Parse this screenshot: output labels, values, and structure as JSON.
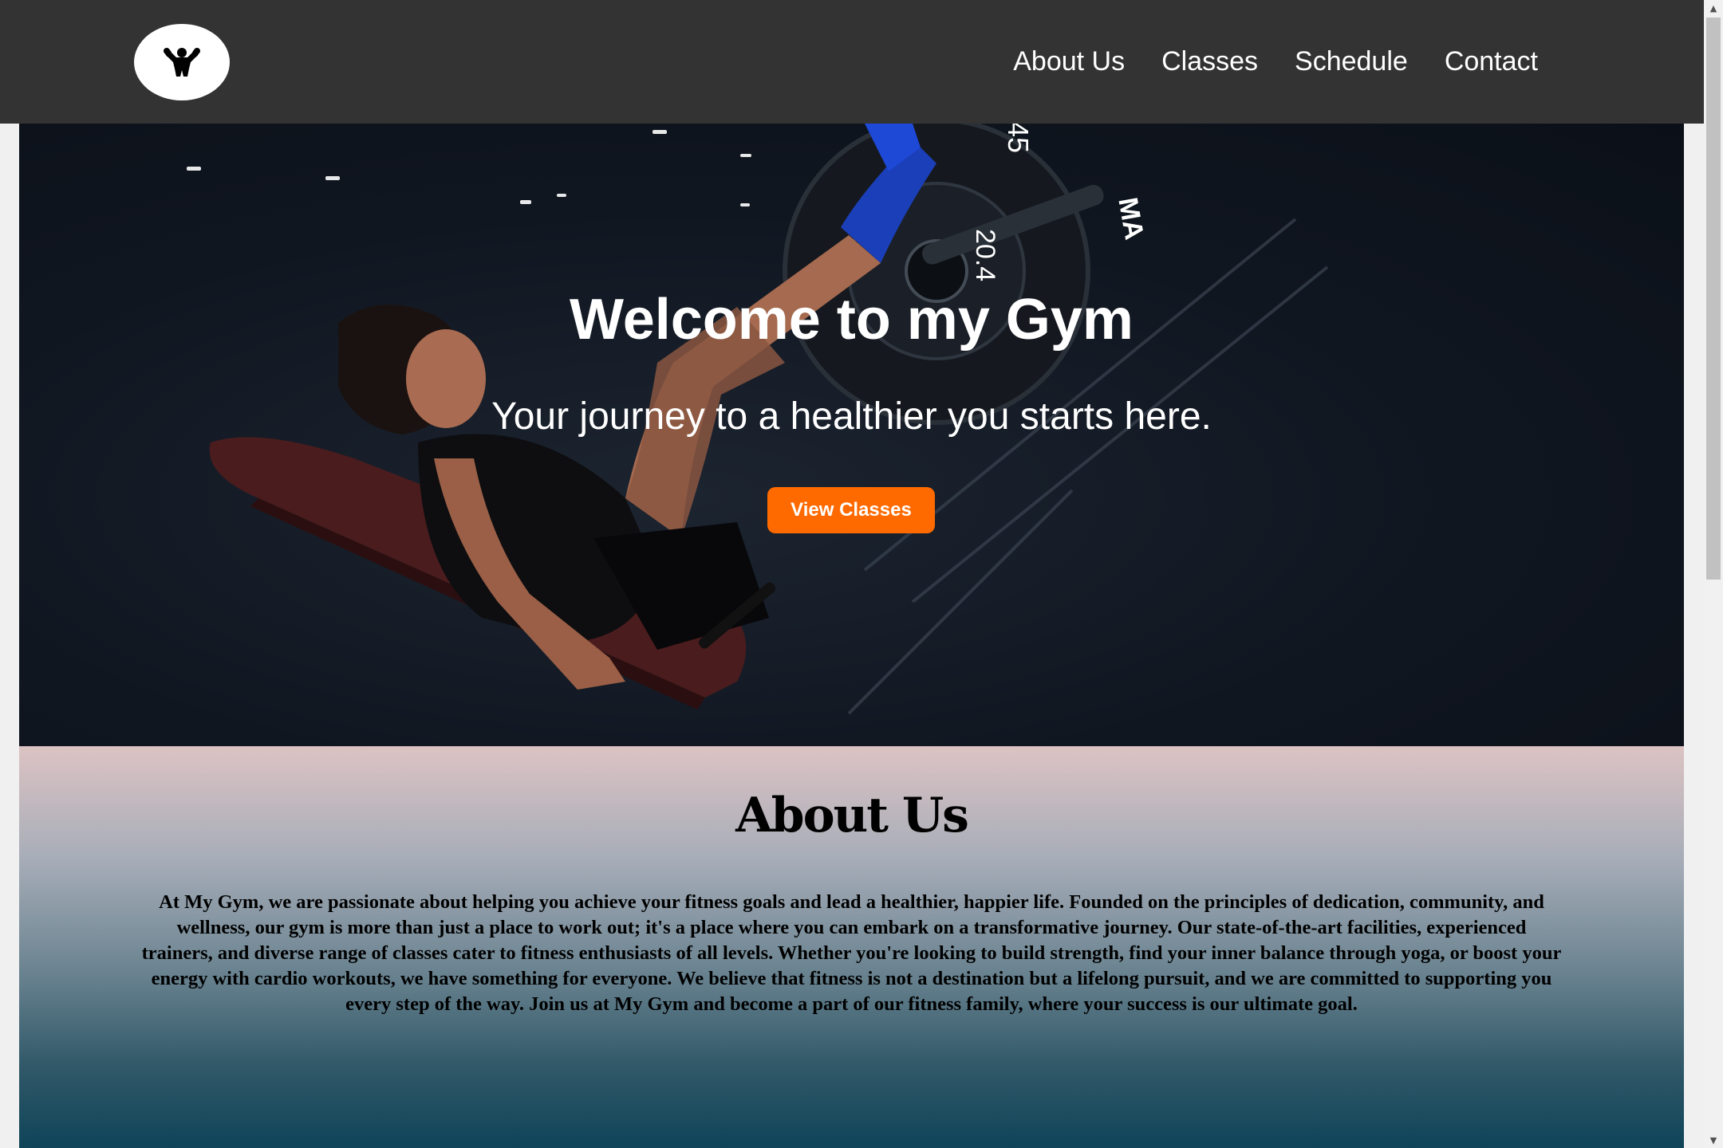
{
  "header": {
    "logo_icon": "flexing-muscle-icon",
    "nav": [
      "About Us",
      "Classes",
      "Schedule",
      "Contact"
    ]
  },
  "hero": {
    "title": "Welcome to my Gym",
    "subtitle": "Your journey to a healthier you starts here.",
    "cta_label": "View Classes",
    "plate_labels": [
      "45",
      "20.4",
      "MA"
    ]
  },
  "about": {
    "heading": "About Us",
    "body": "At My Gym, we are passionate about helping you achieve your fitness goals and lead a healthier, happier life. Founded on the principles of dedication, community, and wellness, our gym is more than just a place to work out; it's a place where you can embark on a transformative journey. Our state-of-the-art facilities, experienced trainers, and diverse range of classes cater to fitness enthusiasts of all levels. Whether you're looking to build strength, find your inner balance through yoga, or boost your energy with cardio workouts, we have something for everyone. We believe that fitness is not a destination but a lifelong pursuit, and we are committed to supporting you every step of the way. Join us at My Gym and become a part of our fitness family, where your success is our ultimate goal."
  },
  "colors": {
    "header_bg": "#333333",
    "accent": "#ff6a00",
    "about_gradient_top": "#dcc3c3",
    "about_gradient_bottom": "#0f4459"
  },
  "scrollbar": {
    "up_icon": "scroll-up-arrow-icon",
    "down_icon": "scroll-down-arrow-icon"
  }
}
